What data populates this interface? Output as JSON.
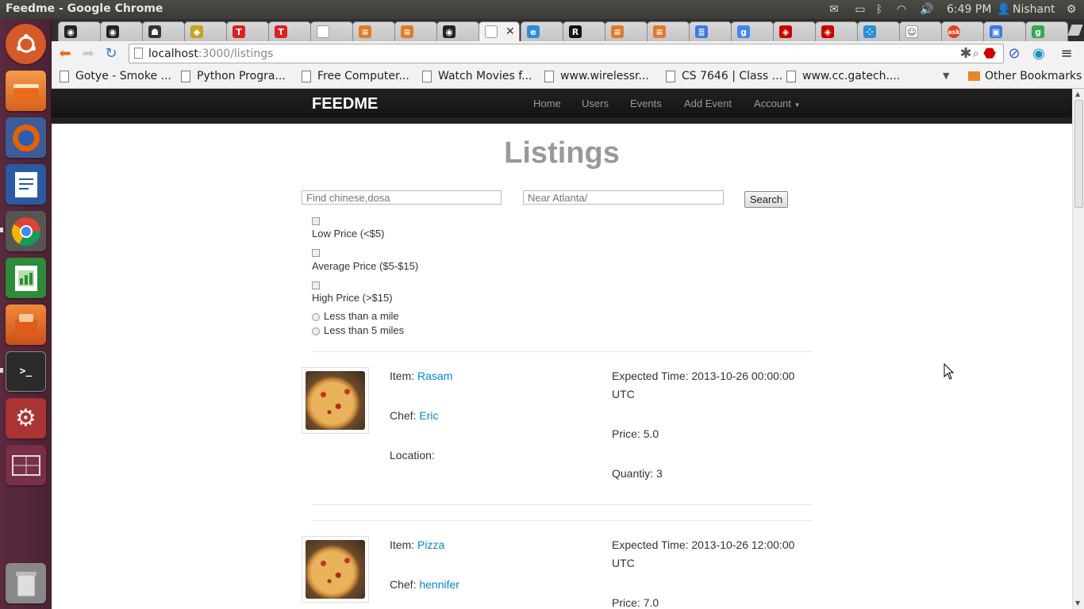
{
  "window": {
    "title": "Feedme - Google Chrome"
  },
  "panel": {
    "time": "6:49 PM",
    "user": "Nishant"
  },
  "browser": {
    "url_host": "localhost",
    "url_path": ":3000/listings",
    "bookmarks": [
      "Gotye - Smoke ...",
      "Python Progra...",
      "Free Computer...",
      "Watch Movies f...",
      "www.wirelessr...",
      "CS 7646 | Class ...",
      "www.cc.gatech...."
    ],
    "other_bookmarks": "Other Bookmarks"
  },
  "nav": {
    "brand": "FEEDME",
    "links": [
      "Home",
      "Users",
      "Events",
      "Add Event",
      "Account"
    ]
  },
  "page": {
    "title": "Listings",
    "find_placeholder": "Find chinese,dosa",
    "near_placeholder": "Near Atlanta/",
    "search_label": "Search",
    "price_filters": [
      "Low Price (<$5)",
      "Average Price ($5-$15)",
      "High Price (>$15)"
    ],
    "distance_filters": [
      "Less than a mile",
      "Less than 5 miles"
    ]
  },
  "listings": [
    {
      "item_label": "Item:",
      "item": "Rasam",
      "chef_label": "Chef:",
      "chef": "Eric",
      "location_label": "Location:",
      "time_label": "Expected Time:",
      "time": "2013-10-26 00:00:00",
      "tz": "UTC",
      "price_label": "Price:",
      "price": "5.0",
      "quantity_label": "Quantiy:",
      "quantity": "3"
    },
    {
      "item_label": "Item:",
      "item": "Pizza",
      "chef_label": "Chef:",
      "chef": "hennifer",
      "time_label": "Expected Time:",
      "time": "2013-10-26 12:00:00",
      "tz": "UTC",
      "price_label": "Price:",
      "price": "7.0"
    }
  ],
  "colors": {
    "launcher": "#5a2a3e",
    "navbar": "#1b1b1b",
    "link": "#0088cc",
    "title": "#999999"
  }
}
